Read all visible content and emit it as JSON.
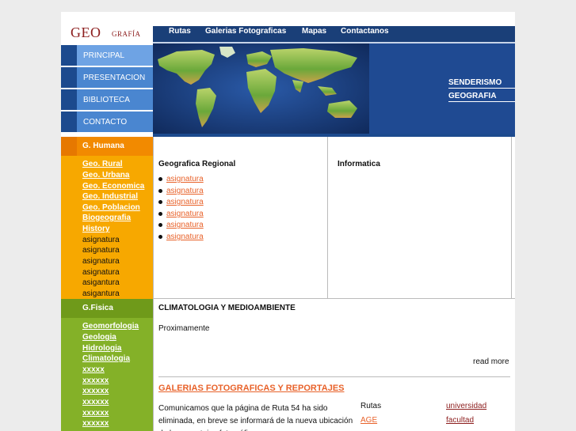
{
  "logo": {
    "geo": "GEO",
    "grafia": "GRAFÍA"
  },
  "topnav": [
    "Rutas",
    "Galerias Fotograficas",
    "Mapas",
    "Contactanos"
  ],
  "leftnav": [
    "PRINCIPAL",
    "PRESENTACION",
    "BIBLIOTECA",
    "CONTACTO"
  ],
  "banner_links": [
    "SENDERISMO",
    "GEOGRAFIA"
  ],
  "humana": {
    "title": "G. Humana",
    "links": [
      "Geo. Rural",
      "Geo. Urbana",
      "Geo. Economica",
      "Geo. Industrial",
      "Geo. Poblacion",
      "Biogeografia",
      "History"
    ],
    "items": [
      "asignatura",
      "asignatura",
      "asignatura",
      "asignatura",
      "asigantura",
      "asigantura"
    ]
  },
  "fisica": {
    "title": "G.Fisica",
    "links": [
      "Geomorfologia",
      "Geologia",
      "Hidrologia",
      "Climatologia",
      "xxxxx",
      "xxxxxx",
      "xxxxxx",
      "xxxxxx",
      "xxxxxx",
      "xxxxxx"
    ]
  },
  "regional": {
    "title": "Geografica Regional",
    "items": [
      "asignatura",
      "asignatura",
      "asignatura",
      "asignatura",
      "asignatura",
      "asignatura"
    ]
  },
  "informatica": {
    "title": "Informatica"
  },
  "clima": {
    "title": "CLIMATOLOGIA Y MEDIOAMBIENTE",
    "text": "Proximamente",
    "readmore": "read more"
  },
  "galerias": {
    "title": "GALERIAS FOTOGRAFICAS Y REPORTAJES",
    "text": "Comunicamos que la página de Ruta 54 ha sido eliminada, en breve se informará de la nueva ubicación de los reportajes fotográficos",
    "col1": [
      "Rutas",
      "AGE"
    ],
    "col2": [
      "universidad",
      "facultad"
    ]
  },
  "colors": {
    "navy": "#1a3f78",
    "blue": "#4a86d0",
    "orange": "#f7a800",
    "green": "#84b128",
    "link": "#e8622a"
  }
}
